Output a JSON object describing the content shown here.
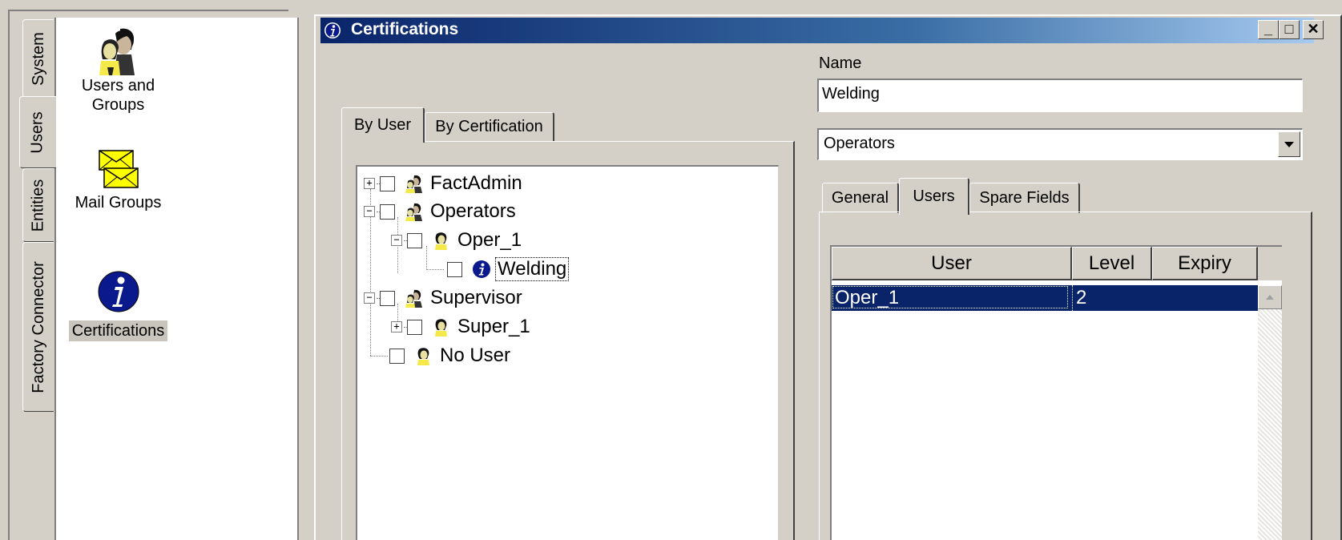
{
  "left_panel": {
    "tabs": [
      {
        "label": "System",
        "icon": "system"
      },
      {
        "label": "Users",
        "icon": "users",
        "active": true
      },
      {
        "label": "Entities",
        "icon": "entities"
      },
      {
        "label": "Factory Connector",
        "icon": "factory"
      }
    ],
    "items": [
      {
        "label_line1": "Users and",
        "label_line2": "Groups",
        "icon": "user-group-icon"
      },
      {
        "label": "Mail Groups",
        "icon": "mail-groups-icon"
      },
      {
        "label": "Certifications",
        "icon": "info-icon",
        "selected": true
      }
    ]
  },
  "window": {
    "title": "Certifications",
    "title_icon": "info-icon",
    "buttons": {
      "minimize": "_",
      "maximize": "□",
      "close": "✕"
    }
  },
  "left_tabs": {
    "tabs": [
      {
        "label": "By User",
        "active": true
      },
      {
        "label": "By Certification"
      }
    ]
  },
  "tree": {
    "nodes": [
      {
        "label": "FactAdmin",
        "expander": "+",
        "icon": "group-icon",
        "checked": false
      },
      {
        "label": "Operators",
        "expander": "−",
        "icon": "group-icon",
        "checked": false
      },
      {
        "label": "Oper_1",
        "expander": "−",
        "icon": "user-icon",
        "checked": false
      },
      {
        "label": "Welding",
        "expander": "",
        "icon": "info-icon",
        "checked": false,
        "focused": true
      },
      {
        "label": "Supervisor",
        "expander": "−",
        "icon": "group-icon",
        "checked": false
      },
      {
        "label": "Super_1",
        "expander": "+",
        "icon": "user-icon",
        "checked": false
      },
      {
        "label": "No User",
        "expander": "",
        "icon": "user-icon",
        "checked": false
      }
    ]
  },
  "form": {
    "name_label": "Name",
    "name_value": "Welding",
    "group_select_value": "Operators"
  },
  "detail_tabs": {
    "tabs": [
      {
        "label": "General"
      },
      {
        "label": "Users",
        "active": true
      },
      {
        "label": "Spare Fields"
      }
    ]
  },
  "grid": {
    "columns": [
      "User",
      "Level",
      "Expiry"
    ],
    "rows": [
      {
        "user": "Oper_1",
        "level": "2",
        "expiry": "",
        "selected": true
      }
    ]
  },
  "colors": {
    "selection": "#0a246a",
    "title_start": "#0a246a",
    "title_end": "#a6caf0",
    "face": "#d4d0c8"
  }
}
